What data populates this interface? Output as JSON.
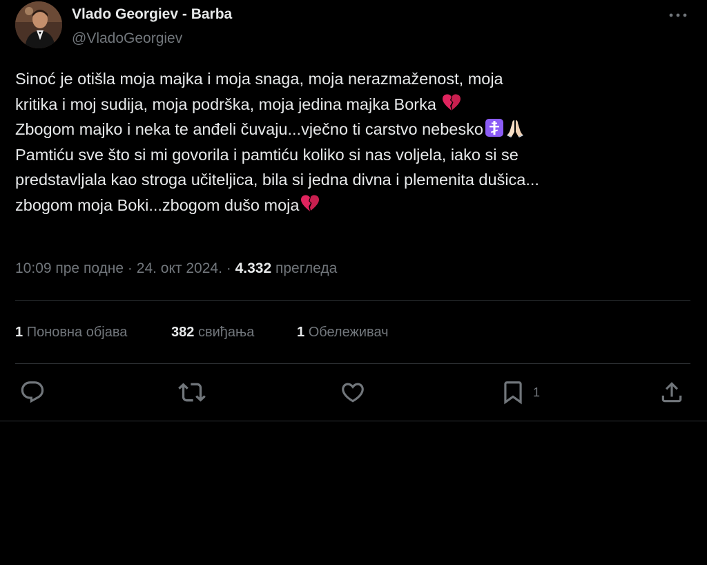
{
  "author": {
    "display_name": "Vlado Georgiev - Barba",
    "handle": "@VladoGeorgiev"
  },
  "tweet": {
    "lines": [
      "Sinoć je otišla moja majka i moja snaga, moja nerazmaženost, moja",
      "kritika i moj sudija, moja podrška, moja jedina majka Borka",
      "Zbogom majko i neka te anđeli čuvaju...vječno ti carstvo nebesko",
      "Pamtiću sve što si mi govorila i pamtiću koliko si nas voljela, iako si se",
      "predstavljala kao stroga učiteljica, bila si jedna divna i plemenita dušica...",
      "zbogom moja Boki...zbogom dušo moja"
    ],
    "emojis": {
      "line2": "broken-heart-icon",
      "line3": [
        "orthodox-cross-icon",
        "folded-hands-icon"
      ],
      "line6": "broken-heart-icon"
    }
  },
  "meta": {
    "time": "10:09 пре подне",
    "separator": "·",
    "date": "24. окт 2024.",
    "views_count": "4.332",
    "views_label": "прегледа"
  },
  "stats": {
    "reposts_count": "1",
    "reposts_label": "Поновна објава",
    "likes_count": "382",
    "likes_label": "свиђања",
    "bookmarks_count": "1",
    "bookmarks_label": "Обележивач"
  },
  "actions": {
    "reply_icon": "reply-icon",
    "repost_icon": "repost-icon",
    "like_icon": "heart-icon",
    "bookmark_icon": "bookmark-icon",
    "bookmark_count": "1",
    "share_icon": "share-icon"
  },
  "colors": {
    "background": "#000000",
    "text_primary": "#e7e9ea",
    "text_secondary": "#71767b",
    "divider": "#2f3336",
    "broken_heart": "#e0245e",
    "cross_bg": "#8b5cf6"
  }
}
